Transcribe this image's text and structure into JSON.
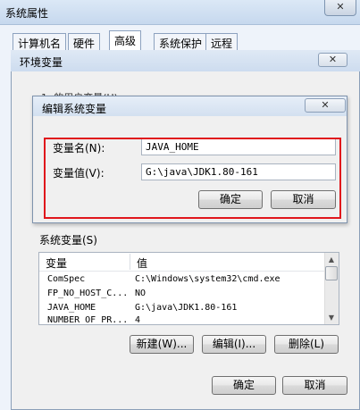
{
  "outer_window": {
    "title": "系统属性",
    "close_glyph": "✕",
    "tabs": [
      {
        "label": "计算机名"
      },
      {
        "label": "硬件"
      },
      {
        "label": "高级"
      },
      {
        "label": "系统保护"
      },
      {
        "label": "远程"
      }
    ]
  },
  "env_window": {
    "title": "环境变量",
    "close_glyph": "✕",
    "user_vars_label": "1: 的用户变量(U)",
    "system_vars_label": "系统变量(S)",
    "columns": [
      "变量",
      "值"
    ],
    "rows": [
      {
        "name": "ComSpec",
        "value": "C:\\Windows\\system32\\cmd.exe"
      },
      {
        "name": "FP_NO_HOST_C...",
        "value": "NO"
      },
      {
        "name": "JAVA_HOME",
        "value": "G:\\java\\JDK1.80-161"
      },
      {
        "name": "NUMBER_OF_PR...",
        "value": "4"
      }
    ],
    "buttons": {
      "new": "新建(W)...",
      "edit": "编辑(I)...",
      "delete": "删除(L)"
    },
    "ok": "确定",
    "cancel": "取消"
  },
  "edit_dialog": {
    "title": "编辑系统变量",
    "close_glyph": "✕",
    "name_label": "变量名(N):",
    "name_value": "JAVA_HOME",
    "value_label": "变量值(V):",
    "value_value": "G:\\java\\JDK1.80-161",
    "ok": "确定",
    "cancel": "取消"
  },
  "colors": {
    "highlight": "#e0161c",
    "selection": "#cce4f7"
  }
}
